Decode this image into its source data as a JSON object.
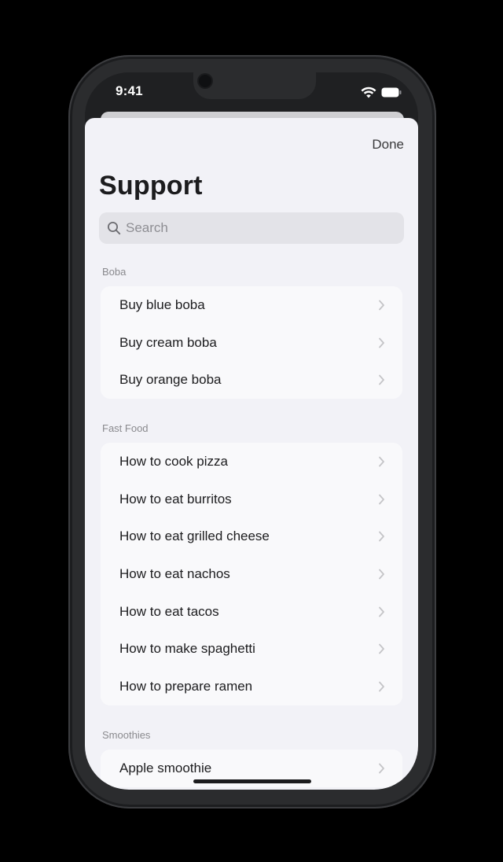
{
  "status_bar": {
    "time": "9:41",
    "wifi_icon": "wifi-icon",
    "battery_icon": "battery-icon"
  },
  "nav": {
    "done_label": "Done",
    "title": "Support"
  },
  "search": {
    "placeholder": "Search",
    "value": "",
    "icon": "search-icon"
  },
  "sections": [
    {
      "header": "Boba",
      "items": [
        {
          "label": "Buy blue boba"
        },
        {
          "label": "Buy cream boba"
        },
        {
          "label": "Buy orange boba"
        }
      ]
    },
    {
      "header": "Fast Food",
      "items": [
        {
          "label": "How to cook pizza"
        },
        {
          "label": "How to eat burritos"
        },
        {
          "label": "How to eat grilled cheese"
        },
        {
          "label": "How to eat nachos"
        },
        {
          "label": "How to eat tacos"
        },
        {
          "label": "How to make spaghetti"
        },
        {
          "label": "How to prepare ramen"
        }
      ]
    },
    {
      "header": "Smoothies",
      "items": [
        {
          "label": "Apple smoothie"
        }
      ]
    }
  ],
  "colors": {
    "sheet_background": "#f2f2f7",
    "group_background": "#f9f9fb",
    "text_primary": "#1c1c1e",
    "text_secondary": "#8a8a8e",
    "chevron": "#c4c4c7",
    "device_frame": "#2b2c2e"
  }
}
